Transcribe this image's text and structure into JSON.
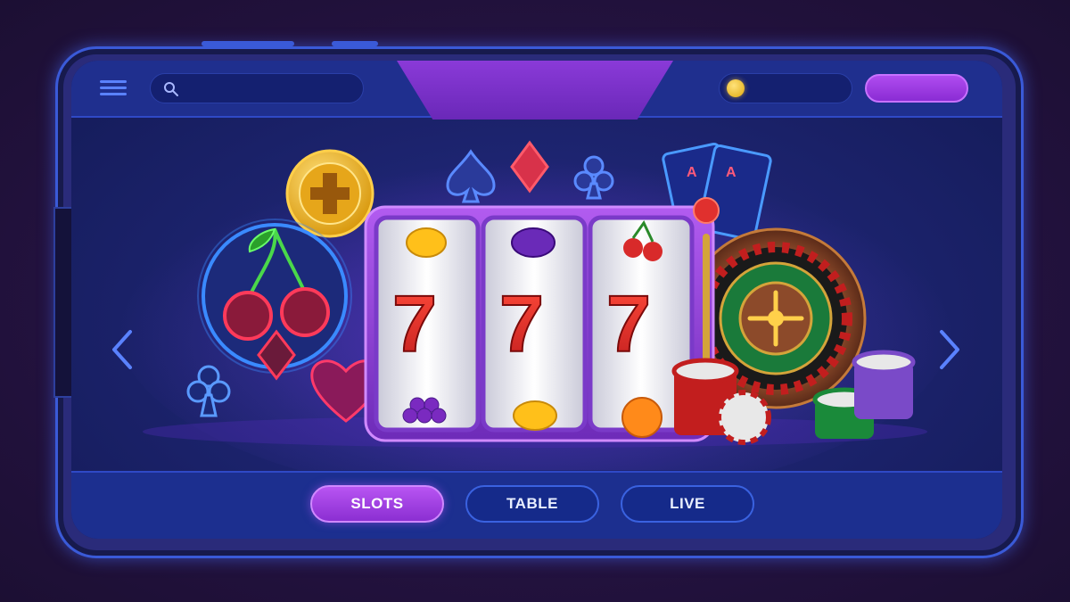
{
  "topbar": {
    "menu_icon": "hamburger-menu-icon",
    "search": {
      "placeholder": "",
      "value": "",
      "icon": "search-icon"
    },
    "balance": {
      "icon": "coin-icon",
      "value": ""
    },
    "action_button_label": ""
  },
  "hero": {
    "slot_machine": {
      "reels": [
        {
          "top": "lemon",
          "middle": "7",
          "bottom": "grapes"
        },
        {
          "top": "plum",
          "middle": "7",
          "bottom": "lemon"
        },
        {
          "top": "cherries",
          "middle": "7",
          "bottom": "orange"
        }
      ]
    },
    "decorations": [
      "cherry-neon-icon",
      "spade-icon",
      "diamond-icon",
      "club-icon",
      "heart-icon",
      "playing-cards-icon",
      "roulette-wheel-icon",
      "poker-chips-icon",
      "casino-chip-icon"
    ],
    "cards_rank": "A"
  },
  "nav": {
    "prev_icon": "chevron-left-icon",
    "next_icon": "chevron-right-icon"
  },
  "tabs": [
    {
      "label": "SLOTS",
      "active": true
    },
    {
      "label": "TABLE",
      "active": false
    },
    {
      "label": "LIVE",
      "active": false
    }
  ],
  "colors": {
    "accent_purple": "#9b3de0",
    "accent_blue": "#3a62e0",
    "seven_red": "#e0302e",
    "background": "#23123f"
  }
}
